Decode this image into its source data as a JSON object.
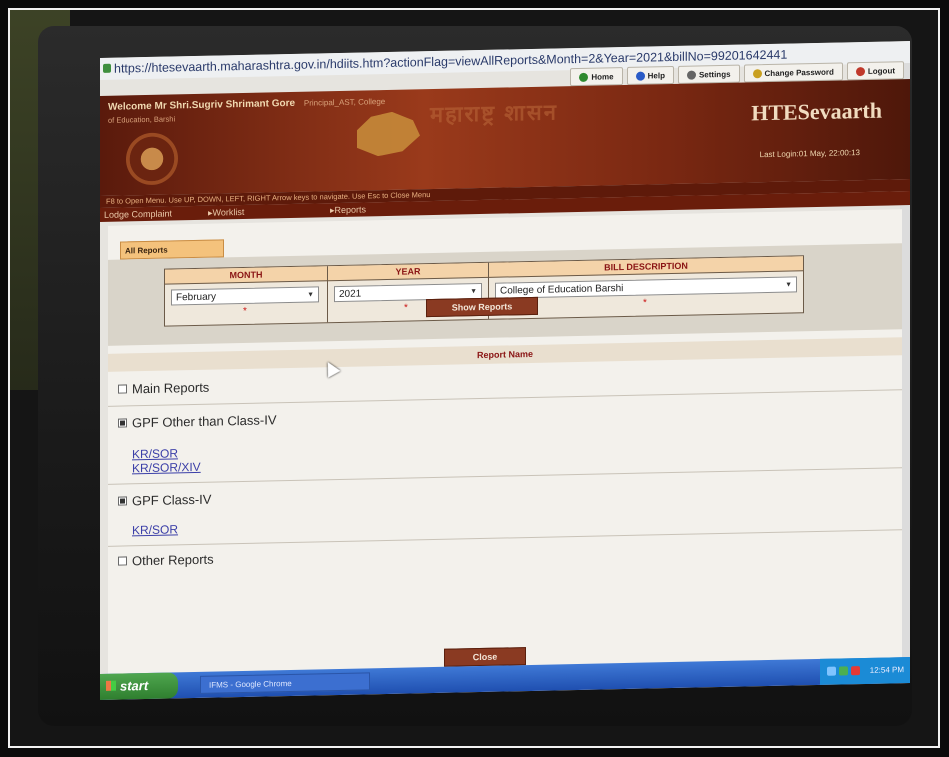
{
  "browser": {
    "url": "https://htesevaarth.maharashtra.gov.in/hdiits.htm?actionFlag=viewAllReports&Month=2&Year=2021&billNo=99201642441"
  },
  "top_nav": [
    {
      "label": "Home",
      "icon": "home-icon"
    },
    {
      "label": "Help",
      "icon": "help-icon"
    },
    {
      "label": "Settings",
      "icon": "settings-icon"
    },
    {
      "label": "Change Password",
      "icon": "password-icon"
    },
    {
      "label": "Logout",
      "icon": "power-icon"
    }
  ],
  "header": {
    "welcome": "Welcome Mr Shri.Sugriv Shrimant Gore",
    "role": "Principal_AST, College",
    "dept": "of Education, Barshi",
    "brand": "HTESevaarth",
    "marathi_text": "महाराष्ट्र शासन",
    "last_login": "Last Login:01 May, 22:00:13"
  },
  "hint_bar": "F8 to Open Menu. Use UP, DOWN, LEFT, RIGHT Arrow keys to navigate. Use Esc to Close Menu",
  "menu": {
    "items": [
      "Lodge Complaint",
      "Worklist",
      "Reports"
    ]
  },
  "tab": {
    "label": "All Reports"
  },
  "filters": {
    "month": {
      "header": "MONTH",
      "value": "February"
    },
    "year": {
      "header": "YEAR",
      "value": "2021"
    },
    "bill": {
      "header": "BILL DESCRIPTION",
      "value": "College of Education Barshi"
    },
    "required_mark": "*"
  },
  "show_reports_label": "Show Reports",
  "report_table_header": "Report Name",
  "reports": [
    {
      "label": "Main Reports",
      "checked": false,
      "links": []
    },
    {
      "label": "GPF Other than Class-IV",
      "checked": true,
      "links": [
        "KR/SOR",
        "KR/SOR/XIV"
      ]
    },
    {
      "label": "GPF Class-IV",
      "checked": true,
      "links": [
        "KR/SOR"
      ]
    },
    {
      "label": "Other Reports",
      "checked": false,
      "links": []
    }
  ],
  "close_label": "Close",
  "taskbar": {
    "start_label": "start",
    "task_item": "IFMS - Google Chrome",
    "clock": "12:54 PM"
  },
  "colors": {
    "header_dark": "#5a1a0c",
    "header_mid": "#9a3a1b",
    "button": "#8a3a22",
    "tab": "#f4c27c",
    "link": "#3b3fa8",
    "required": "#cc1b1b"
  }
}
